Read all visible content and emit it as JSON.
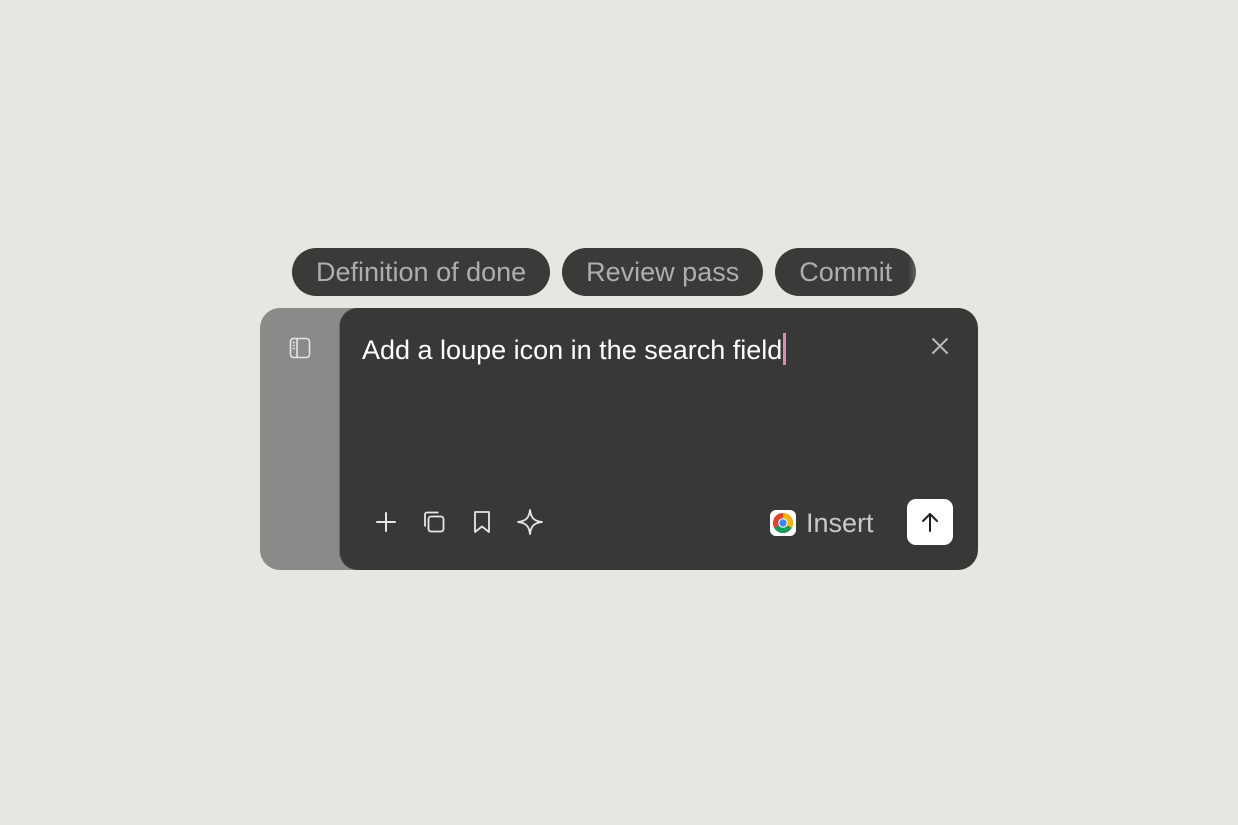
{
  "chips": [
    {
      "label": "Definition of done",
      "icon": null
    },
    {
      "label": "Review pass",
      "icon": null
    },
    {
      "label": "Commit",
      "icon": null
    }
  ],
  "composer": {
    "text": "Add a loupe icon in the search field",
    "caret_color": "#d590b4"
  },
  "sidebar": {
    "toggle_icon": "sidebar-panel-icon"
  },
  "toolbar": {
    "tools": [
      {
        "name": "add",
        "icon": "plus-icon"
      },
      {
        "name": "duplicate",
        "icon": "copy-icon"
      },
      {
        "name": "bookmark",
        "icon": "bookmark-icon"
      },
      {
        "name": "sparkle",
        "icon": "sparkle-icon"
      }
    ],
    "insert_label": "Insert",
    "insert_icon": "chrome-icon",
    "send_icon": "arrow-up-icon",
    "close_icon": "close-icon"
  },
  "colors": {
    "background": "#e8e6e1",
    "panel": "#383837",
    "rail": "#8a8a88",
    "chip": "#3a3a39",
    "chip_text": "#aeaeab"
  }
}
